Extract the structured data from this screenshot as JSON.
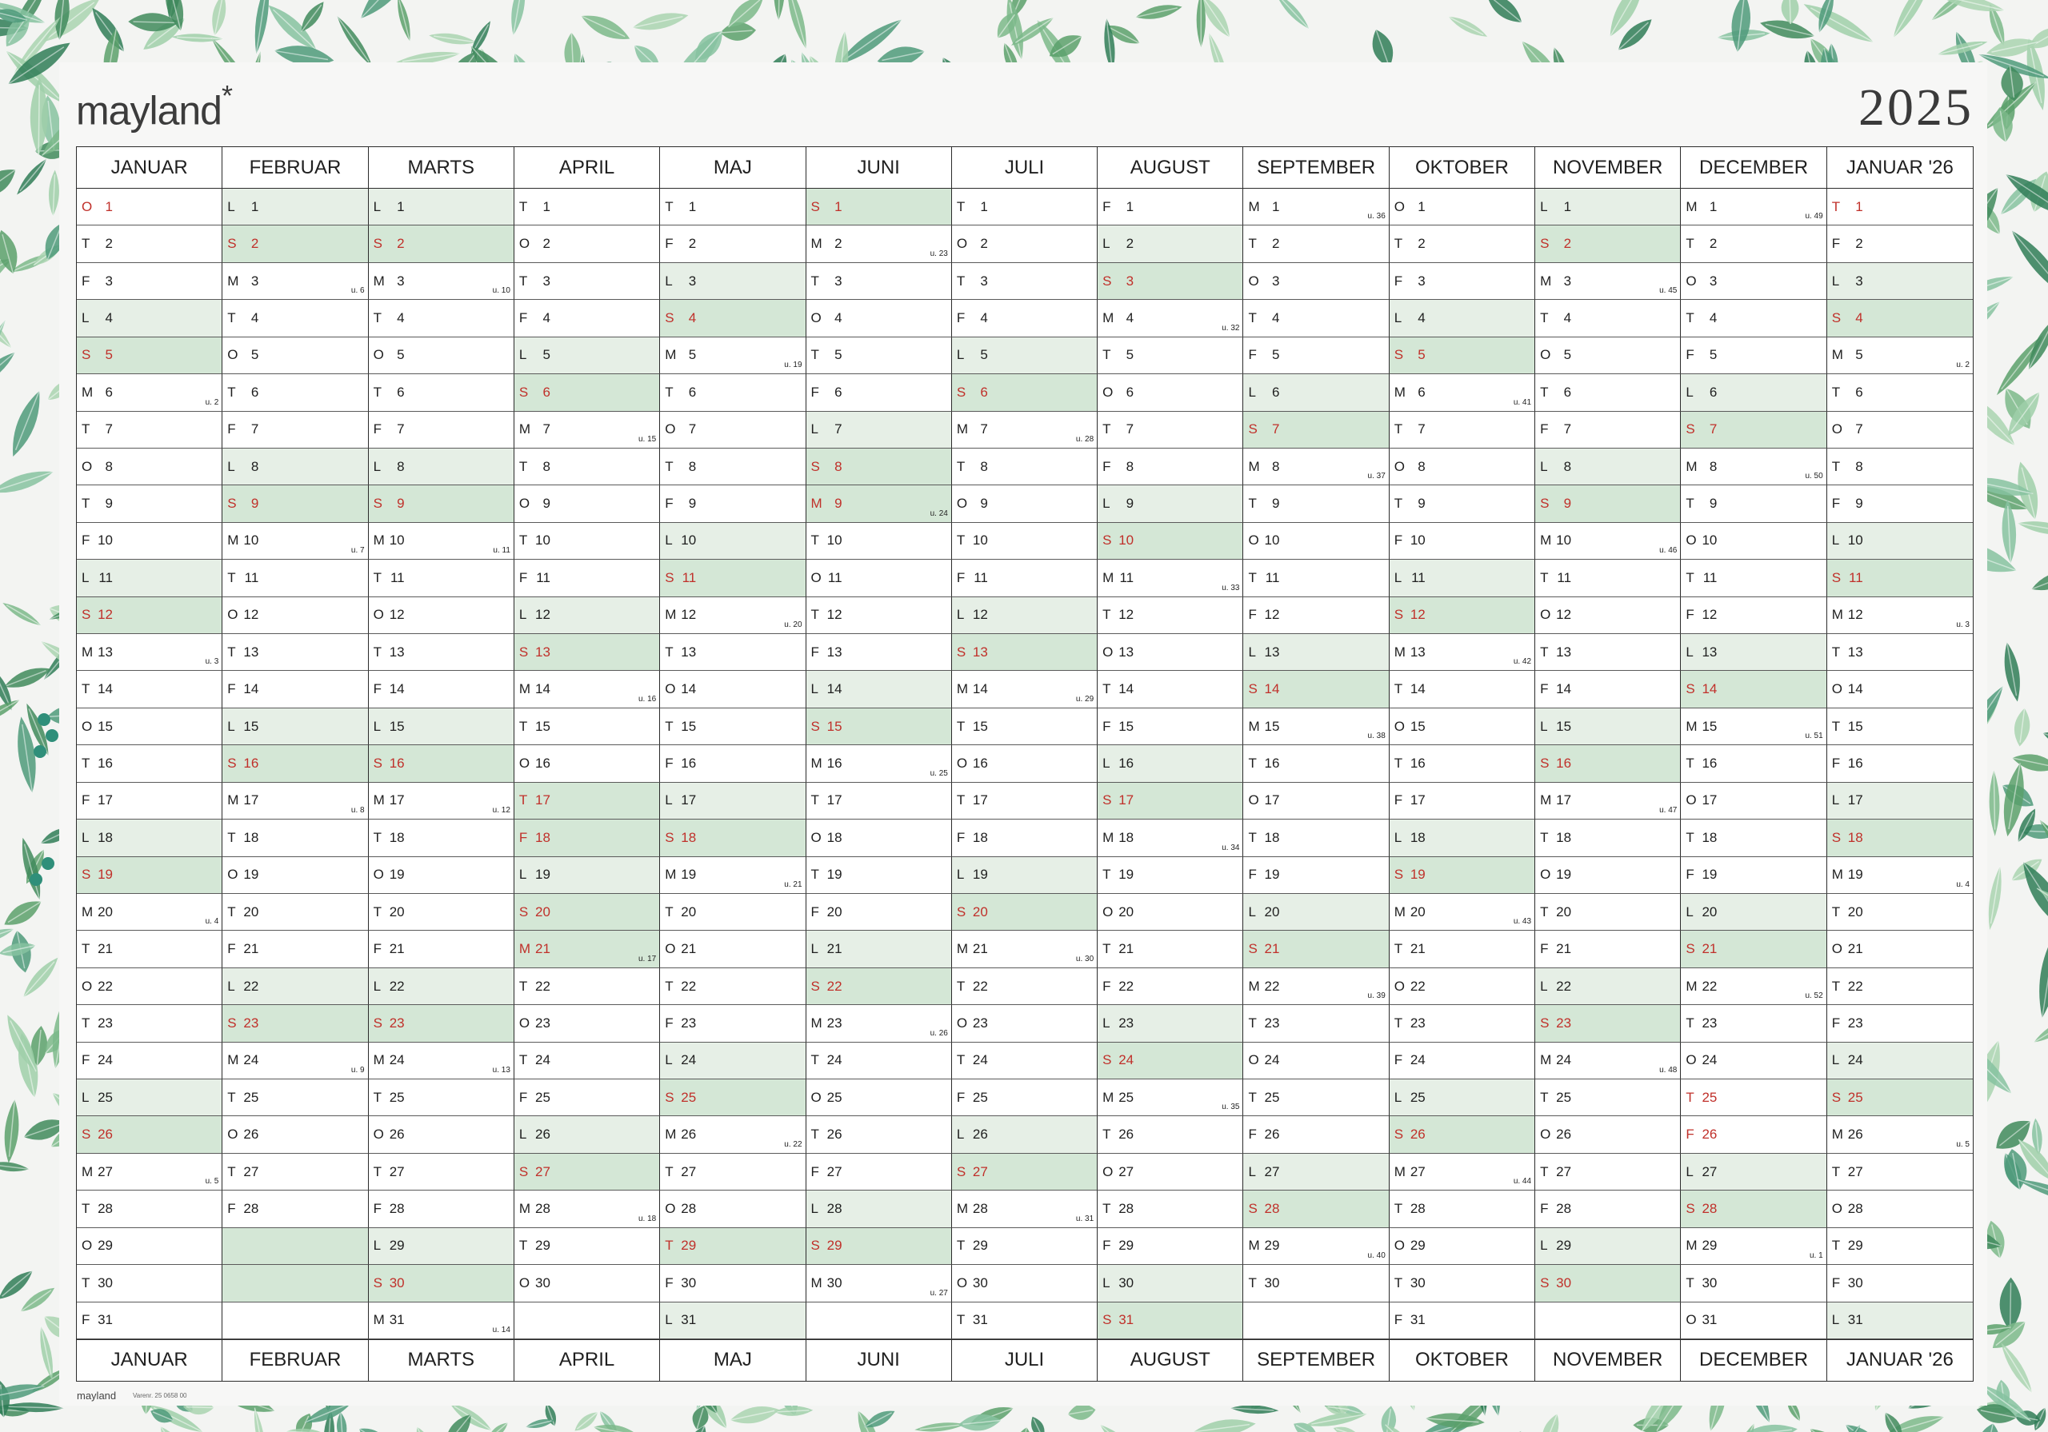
{
  "brand": "mayland",
  "year": "2025",
  "footer": {
    "brand": "mayland",
    "code": "Varenr. 25 0658 00"
  },
  "colors": {
    "weekend": "#e6efe6",
    "sunday": "#d4e7d6",
    "holiday_text": "#c0302a",
    "grid": "#2b2b2b"
  },
  "months": [
    {
      "name": "JANUAR",
      "start": 3,
      "days": 31,
      "year": 2025,
      "month": 1
    },
    {
      "name": "FEBRUAR",
      "start": 6,
      "days": 28,
      "year": 2025,
      "month": 2
    },
    {
      "name": "MARTS",
      "start": 6,
      "days": 31,
      "year": 2025,
      "month": 3
    },
    {
      "name": "APRIL",
      "start": 2,
      "days": 30,
      "year": 2025,
      "month": 4
    },
    {
      "name": "MAJ",
      "start": 4,
      "days": 31,
      "year": 2025,
      "month": 5
    },
    {
      "name": "JUNI",
      "start": 0,
      "days": 30,
      "year": 2025,
      "month": 6
    },
    {
      "name": "JULI",
      "start": 2,
      "days": 31,
      "year": 2025,
      "month": 7
    },
    {
      "name": "AUGUST",
      "start": 5,
      "days": 31,
      "year": 2025,
      "month": 8
    },
    {
      "name": "SEPTEMBER",
      "start": 1,
      "days": 30,
      "year": 2025,
      "month": 9
    },
    {
      "name": "OKTOBER",
      "start": 3,
      "days": 31,
      "year": 2025,
      "month": 10
    },
    {
      "name": "NOVEMBER",
      "start": 6,
      "days": 30,
      "year": 2025,
      "month": 11
    },
    {
      "name": "DECEMBER",
      "start": 1,
      "days": 31,
      "year": 2025,
      "month": 12
    },
    {
      "name": "JANUAR '26",
      "start": 4,
      "days": 31,
      "year": 2026,
      "month": 1
    }
  ],
  "weekday_letters": [
    "S",
    "M",
    "T",
    "O",
    "T",
    "F",
    "L"
  ],
  "week_prefix": "u.",
  "holidays": [
    "2025-1-1",
    "2025-4-17",
    "2025-4-18",
    "2025-4-21",
    "2025-5-29",
    "2025-6-9",
    "2025-12-25",
    "2025-12-26",
    "2026-1-1"
  ],
  "holiday_shade": [
    "2025-4-17",
    "2025-4-18",
    "2025-4-21",
    "2025-5-29",
    "2025-6-9"
  ]
}
